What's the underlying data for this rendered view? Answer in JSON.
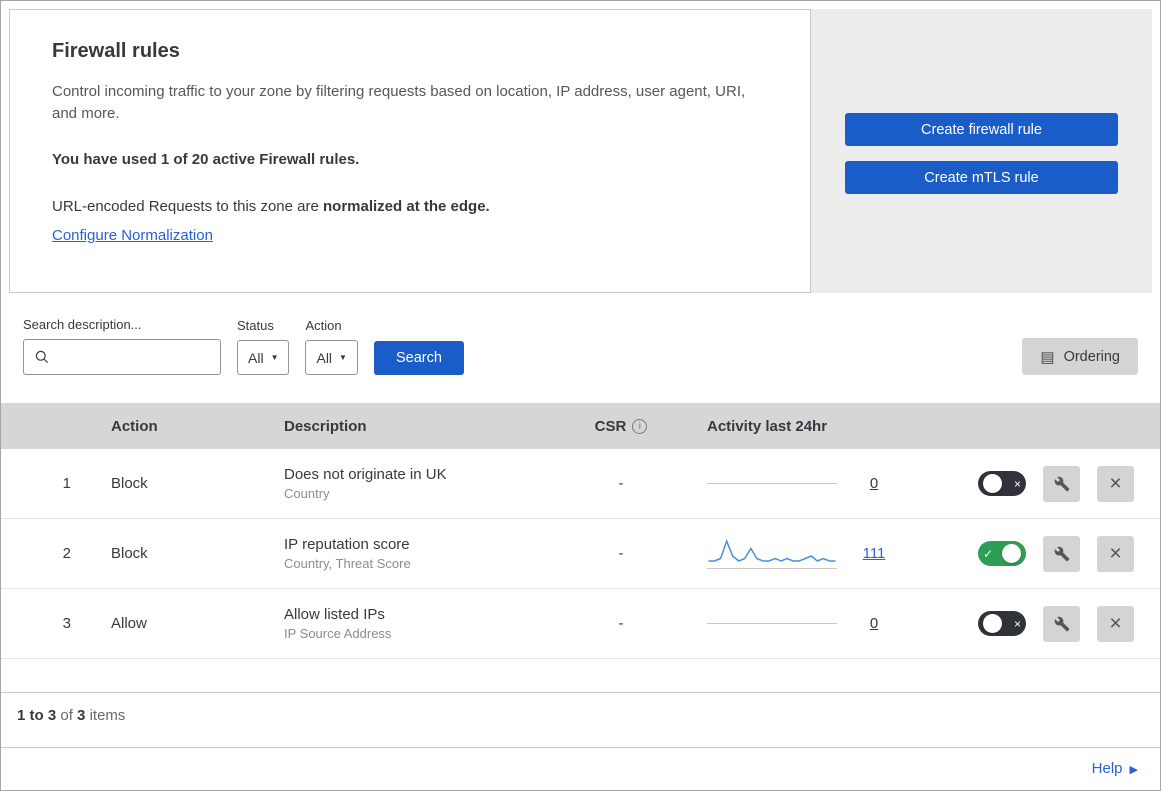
{
  "colors": {
    "primary_blue": "#1a5dc8",
    "link_blue": "#2762d9",
    "toggle_on_green": "#2f9e55",
    "toggle_off_dark": "#30343a",
    "sparkline_blue": "#4a90d9",
    "panel_gray": "#ededed",
    "table_header_gray": "#d6d6d6"
  },
  "header": {
    "title": "Firewall rules",
    "description": "Control incoming traffic to your zone by filtering requests based on location, IP address, user agent, URI, and more.",
    "usage": "You have used 1 of 20 active Firewall rules.",
    "normalization_prefix": "URL-encoded Requests to this zone are ",
    "normalization_bold": "normalized at the edge.",
    "normalization_link": "Configure Normalization",
    "create_firewall_button": "Create firewall rule",
    "create_mtls_button": "Create mTLS rule"
  },
  "toolbar": {
    "search_label": "Search description...",
    "status_label": "Status",
    "status_value": "All",
    "action_label": "Action",
    "action_value": "All",
    "search_button": "Search",
    "ordering_button": "Ordering"
  },
  "table": {
    "headers": {
      "action": "Action",
      "description": "Description",
      "csr": "CSR",
      "activity": "Activity last 24hr"
    },
    "rows": [
      {
        "number": "1",
        "action": "Block",
        "description": "Does not originate in UK",
        "criteria": "Country",
        "csr": "-",
        "activity_count": "0",
        "enabled": false
      },
      {
        "number": "2",
        "action": "Block",
        "description": "IP reputation score",
        "criteria": "Country, Threat Score",
        "csr": "-",
        "activity_count": "111",
        "enabled": true,
        "sparkline": [
          2,
          2,
          3,
          10,
          4,
          2,
          3,
          7,
          3,
          2,
          2,
          3,
          2,
          3,
          2,
          2,
          3,
          4,
          2,
          3,
          2,
          2
        ]
      },
      {
        "number": "3",
        "action": "Allow",
        "description": "Allow listed IPs",
        "criteria": "IP Source Address",
        "csr": "-",
        "activity_count": "0",
        "enabled": false
      }
    ]
  },
  "footer": {
    "range": "1 to 3",
    "of_label": "of",
    "total": "3",
    "items_label": "items",
    "help": "Help"
  },
  "icons": {
    "ordering": "▤",
    "caret": "▼",
    "info": "i",
    "check": "✓",
    "cross": "×",
    "close": "×",
    "help_arrow": "▶"
  }
}
